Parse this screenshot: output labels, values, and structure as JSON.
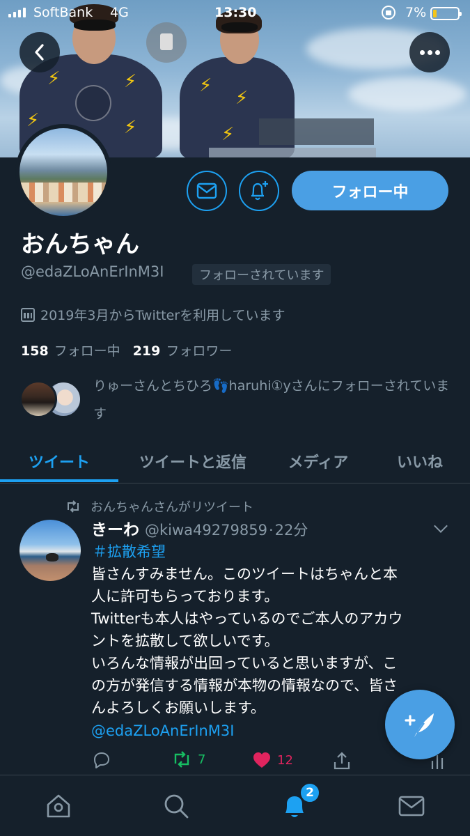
{
  "status_bar": {
    "carrier": "SoftBank",
    "network": "4G",
    "time": "13:30",
    "battery_percent": "7%",
    "battery_level": 0.07
  },
  "banner": {
    "back_icon": "chevron-left-icon",
    "more_icon": "more-horizontal-icon"
  },
  "profile": {
    "display_name": "おんちゃん",
    "handle": "@edaZLoAnErInM3I",
    "follows_you": "フォローされています",
    "joined": "2019年3月からTwitterを利用しています",
    "following_count": "158",
    "following_label": "フォロー中",
    "followers_count": "219",
    "followers_label": "フォロワー",
    "followed_by": "りゅーさんとちひろ👣haruhi①yさんにフォローされています",
    "follow_button": "フォロー中"
  },
  "tabs": [
    {
      "label": "ツイート",
      "active": true
    },
    {
      "label": "ツイートと返信",
      "active": false
    },
    {
      "label": "メディア",
      "active": false
    },
    {
      "label": "いいね",
      "active": false
    }
  ],
  "tweet": {
    "retweeted_by": "おんちゃんさんがリツイート",
    "display_name": "きーわ",
    "handle": "@kiwa49279859",
    "separator": "·",
    "time": "22分",
    "hashtag": "＃拡散希望",
    "body_lines": [
      "皆さんすみません。このツイートはちゃんと本",
      "人に許可もらっております。",
      "Twitterも本人はやっているのでご本人のアカウ",
      "ントを拡散して欲しいです。",
      "いろんな情報が出回っていると思いますが、こ",
      "の方が発信する情報が本物の情報なので、皆さ",
      "んよろしくお願いします。"
    ],
    "mention": "@edaZLoAnErInM3I",
    "retweet_count": "7",
    "like_count": "12"
  },
  "bottom_nav": {
    "items": [
      "home-icon",
      "search-icon",
      "bell-icon",
      "mail-icon"
    ],
    "notification_badge": "2"
  },
  "colors": {
    "background": "#15202b",
    "accent": "#1da1f2",
    "muted": "#8899a6",
    "retweet": "#17bf63",
    "like": "#e0245e"
  }
}
